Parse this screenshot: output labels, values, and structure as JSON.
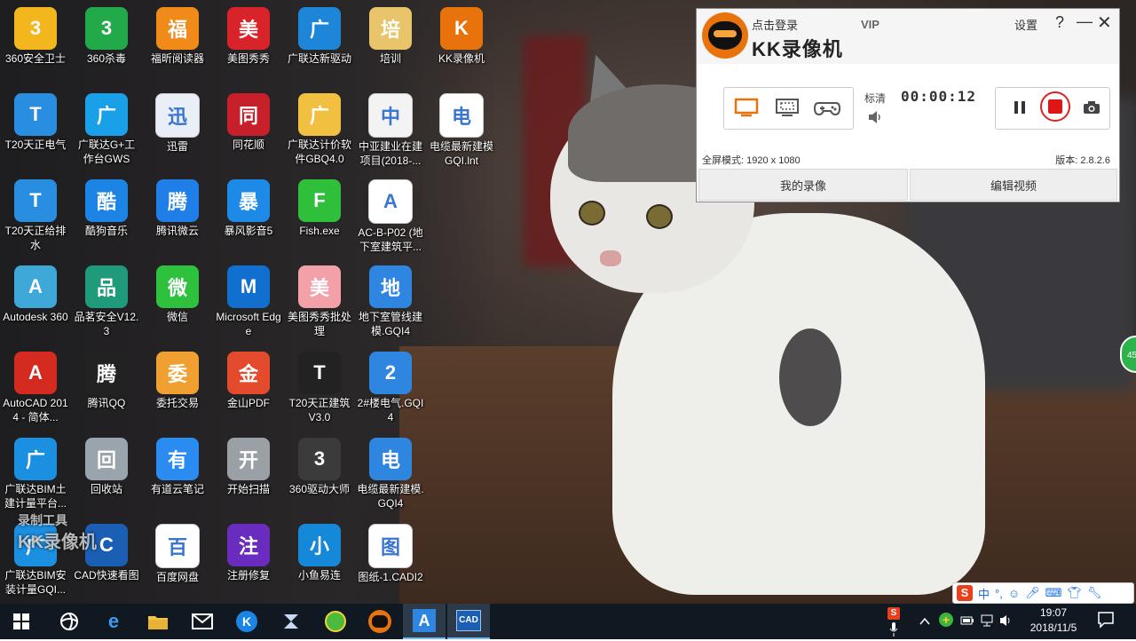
{
  "desktop": {
    "icons": [
      {
        "label": "360安全卫士",
        "icon": "360-safe-icon",
        "color": "#f3b61d"
      },
      {
        "label": "360杀毒",
        "icon": "360-antivirus-icon",
        "color": "#22a94a"
      },
      {
        "label": "福昕阅读器",
        "icon": "foxit-pdf-icon",
        "color": "#f08a18"
      },
      {
        "label": "美图秀秀",
        "icon": "meitu-icon",
        "color": "#d8232a"
      },
      {
        "label": "广联达新驱动",
        "icon": "glodon-driver-icon",
        "color": "#1e86d8"
      },
      {
        "label": "培训",
        "icon": "folder-icon",
        "color": "#e8c56a"
      },
      {
        "label": "KK录像机",
        "icon": "kk-recorder-icon",
        "color": "#e8730c"
      },
      {
        "label": "T20天正电气",
        "icon": "t20-electric-icon",
        "color": "#2a8ee0"
      },
      {
        "label": "广联达G+工作台GWS",
        "icon": "glodon-gws-icon",
        "color": "#1aa0e8"
      },
      {
        "label": "迅雷",
        "icon": "xunlei-icon",
        "color": "#eaeff7"
      },
      {
        "label": "同花顺",
        "icon": "tonghuashun-icon",
        "color": "#c8202a"
      },
      {
        "label": "广联达计价软件GBQ4.0",
        "icon": "glodon-gbq-icon",
        "color": "#f2c040"
      },
      {
        "label": "中亚建业在建项目(2018-...",
        "icon": "document-icon",
        "color": "#f3f3f3"
      },
      {
        "label": "电缆最新建模GQI.lnt",
        "icon": "blank-file-icon",
        "color": "#ffffff"
      },
      {
        "label": "T20天正给排水",
        "icon": "t20-water-icon",
        "color": "#2a8ee0"
      },
      {
        "label": "酷狗音乐",
        "icon": "kugou-icon",
        "color": "#1b84e4"
      },
      {
        "label": "腾讯微云",
        "icon": "weiyun-icon",
        "color": "#1f7ee8"
      },
      {
        "label": "暴风影音5",
        "icon": "baofeng-icon",
        "color": "#1d8ae8"
      },
      {
        "label": "Fish.exe",
        "icon": "fish-icon",
        "color": "#2fbf3a"
      },
      {
        "label": "AC-B-P02 (地下室建筑平...",
        "icon": "cad-thumbnail-icon",
        "color": "#ffffff"
      },
      {
        "label": "Autodesk 360",
        "icon": "autodesk-360-icon",
        "color": "#3ea8d8"
      },
      {
        "label": "品茗安全V12.3",
        "icon": "pinming-icon",
        "color": "#1f9b7c"
      },
      {
        "label": "微信",
        "icon": "wechat-icon",
        "color": "#2dc13e"
      },
      {
        "label": "Microsoft Edge",
        "icon": "edge-icon",
        "color": "#1170cf"
      },
      {
        "label": "美图秀秀批处理",
        "icon": "meitu-batch-icon",
        "color": "#f3a0a8"
      },
      {
        "label": "地下室管线建模.GQI4",
        "icon": "gqi-file-icon",
        "color": "#2f86e0"
      },
      {
        "label": "AutoCAD 2014 - 简体...",
        "icon": "autocad-icon",
        "color": "#d42a20"
      },
      {
        "label": "腾讯QQ",
        "icon": "qq-icon",
        "color": "#222222"
      },
      {
        "label": "委托交易",
        "icon": "house-trade-icon",
        "color": "#f0a030"
      },
      {
        "label": "金山PDF",
        "icon": "wps-pdf-icon",
        "color": "#e44b2c"
      },
      {
        "label": "T20天正建筑V3.0",
        "icon": "t20-arch-icon",
        "color": "#222222"
      },
      {
        "label": "2#楼电气.GQI4",
        "icon": "gqi-file-icon",
        "color": "#2f86e0"
      },
      {
        "label": "广联达BIM土建计量平台...",
        "icon": "glodon-bim-icon",
        "color": "#1b8fe0"
      },
      {
        "label": "回收站",
        "icon": "recycle-bin-icon",
        "color": "#9aa4ad"
      },
      {
        "label": "有道云笔记",
        "icon": "youdao-note-icon",
        "color": "#2a8cf0"
      },
      {
        "label": "开始扫描",
        "icon": "scanner-icon",
        "color": "#9aa0a6"
      },
      {
        "label": "360驱动大师",
        "icon": "360-driver-icon",
        "color": "#3b3b3b"
      },
      {
        "label": "电缆最新建模.GQI4",
        "icon": "gqi-file-icon",
        "color": "#2f86e0"
      },
      {
        "label": "广联达BIM安装计量GQI...",
        "icon": "glodon-bim-install-icon",
        "color": "#1b8fe0"
      },
      {
        "label": "CAD快速看图",
        "icon": "cad-viewer-icon",
        "color": "#1a5fb4"
      },
      {
        "label": "百度网盘",
        "icon": "baidu-pan-icon",
        "color": "#ffffff"
      },
      {
        "label": "注册修复",
        "icon": "registry-fix-icon",
        "color": "#6a2cbf"
      },
      {
        "label": "小鱼易连",
        "icon": "xiaoyu-icon",
        "color": "#1688d8"
      },
      {
        "label": "图纸-1.CADI2",
        "icon": "blank-file-icon",
        "color": "#ffffff"
      }
    ]
  },
  "kk": {
    "login": "点击登录",
    "vip": "VIP",
    "title": "KK录像机",
    "settings": "设置",
    "help": "?",
    "minimize": "—",
    "close": "✕",
    "quality": "标清",
    "timer": "00:00:12",
    "fullscreen": "全屏模式: 1920 x 1080",
    "version": "版本: 2.8.2.6",
    "my_recordings": "我的录像",
    "edit_video": "编辑视频",
    "accent": "#e8730c",
    "record_color": "#e01616"
  },
  "watermark": {
    "line1": "录制工具",
    "line2": "KK录像机"
  },
  "side_badge": "45",
  "ime": {
    "mode": "中"
  },
  "taskbar": {
    "apps": [
      "windows-start-icon",
      "task-view-icon",
      "edge-icon",
      "file-explorer-icon",
      "mail-icon",
      "kugou-icon",
      "xunlei-icon",
      "360-browser-icon",
      "kk-recorder-icon",
      "glodon-gqi-icon",
      "cad-viewer-icon"
    ],
    "time": "19:07",
    "date": "2018/11/5"
  }
}
